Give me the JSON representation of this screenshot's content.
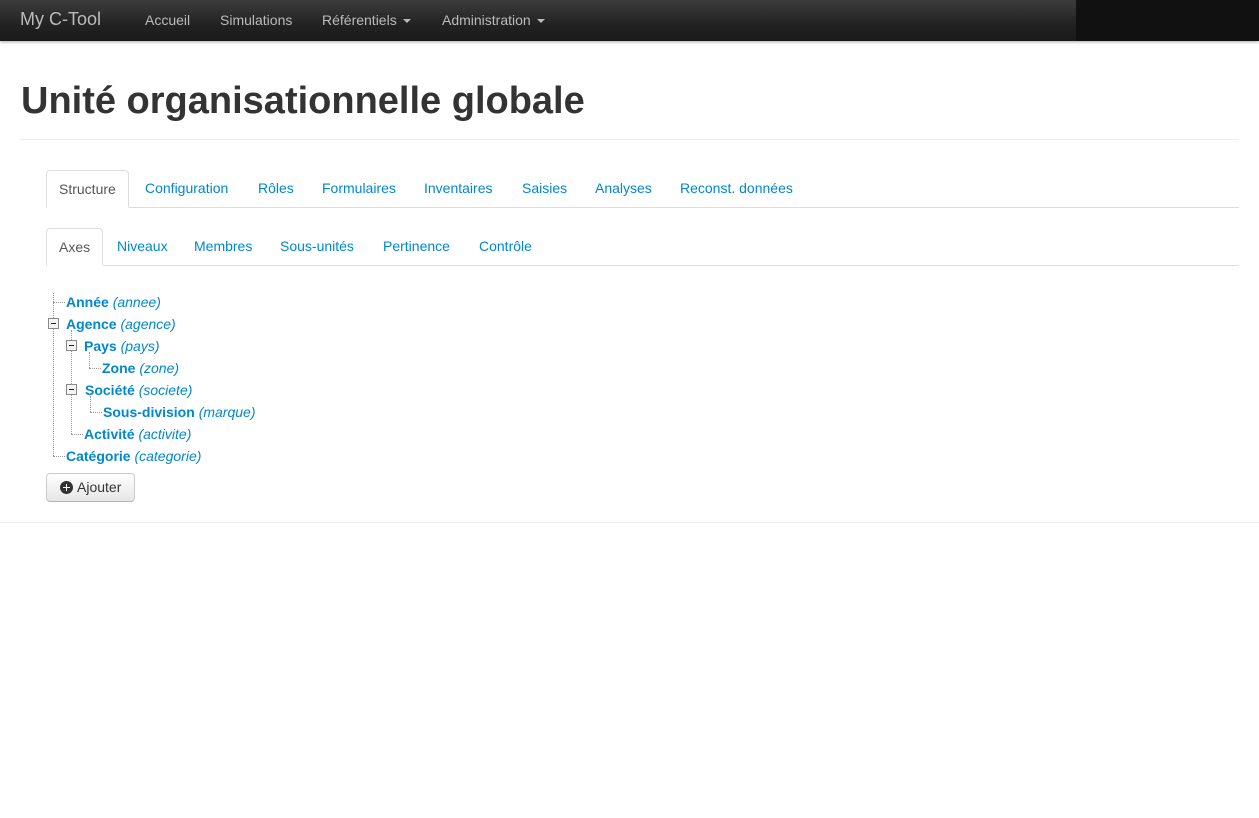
{
  "navbar": {
    "brand": "My C-Tool",
    "items": [
      {
        "label": "Accueil",
        "dropdown": false
      },
      {
        "label": "Simulations",
        "dropdown": false
      },
      {
        "label": "Référentiels",
        "dropdown": true
      },
      {
        "label": "Administration",
        "dropdown": true
      }
    ]
  },
  "page": {
    "title": "Unité organisationnelle globale"
  },
  "main_tabs": [
    "Structure",
    "Configuration",
    "Rôles",
    "Formulaires",
    "Inventaires",
    "Saisies",
    "Analyses",
    "Reconst. données"
  ],
  "main_tabs_active": "Structure",
  "sub_tabs": [
    "Axes",
    "Niveaux",
    "Membres",
    "Sous-unités",
    "Pertinence",
    "Contrôle"
  ],
  "sub_tabs_active": "Axes",
  "tree": [
    {
      "label": "Année",
      "ref": "(annee)",
      "expanded": null
    },
    {
      "label": "Agence",
      "ref": "(agence)",
      "expanded": true
    },
    {
      "label": "Pays",
      "ref": "(pays)",
      "expanded": true
    },
    {
      "label": "Zone",
      "ref": "(zone)",
      "expanded": null
    },
    {
      "label": "Société",
      "ref": "(societe)",
      "expanded": true
    },
    {
      "label": "Sous-division",
      "ref": "(marque)",
      "expanded": null
    },
    {
      "label": "Activité",
      "ref": "(activite)",
      "expanded": null
    },
    {
      "label": "Catégorie",
      "ref": "(categorie)",
      "expanded": null
    }
  ],
  "actions": {
    "add_label": "Ajouter",
    "add_icon": "plus-circle-icon"
  },
  "colors": {
    "link": "#0088cc",
    "navbar": "#222222",
    "title": "#333333"
  }
}
